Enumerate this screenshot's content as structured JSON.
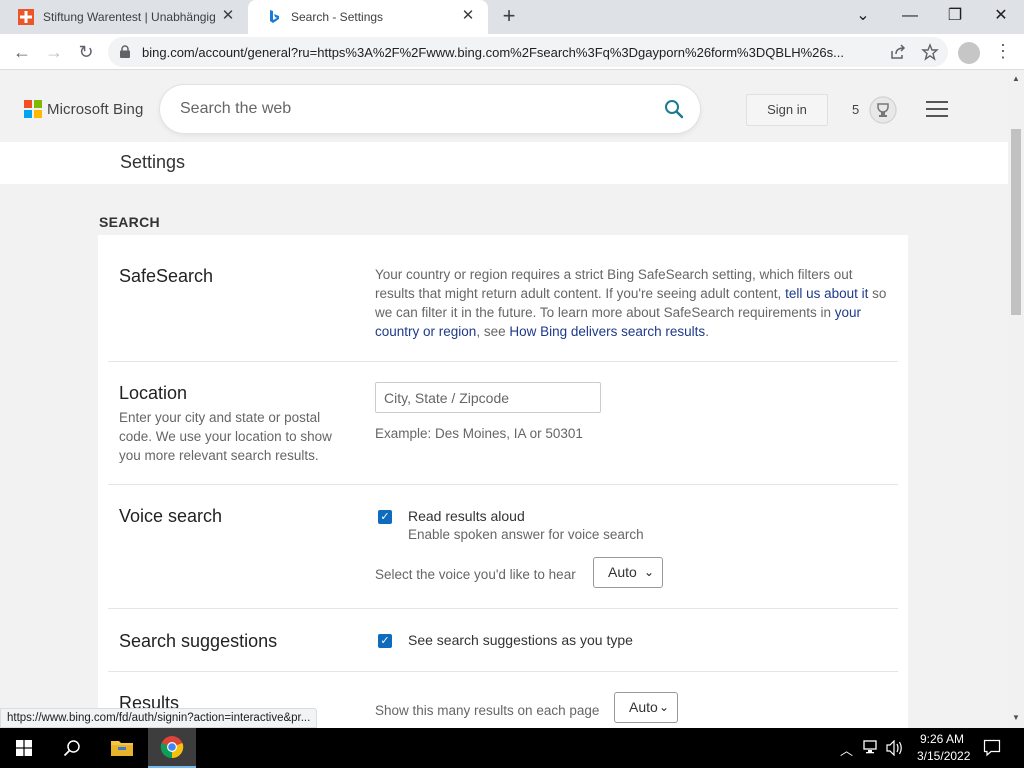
{
  "browser": {
    "tabs": [
      {
        "title": "Stiftung Warentest | Unabhängig",
        "favicon": "stiftung-warentest-icon",
        "active": false
      },
      {
        "title": "Search - Settings",
        "favicon": "bing-icon",
        "active": true
      }
    ],
    "url": "bing.com/account/general?ru=https%3A%2F%2Fwww.bing.com%2Fsearch%3Fq%3Dgayporn%26form%3DQBLH%26s...",
    "status_url": "https://www.bing.com/fd/auth/signin?action=interactive&pr..."
  },
  "header": {
    "brand": "Microsoft Bing",
    "search_placeholder": "Search the web",
    "sign_in": "Sign in",
    "rewards_count": "5"
  },
  "settings": {
    "page_title": "Settings",
    "section": "SEARCH",
    "safesearch": {
      "title": "SafeSearch",
      "text_1": "Your country or region requires a strict Bing SafeSearch setting, which filters out results that might return adult content. If you're seeing adult content, ",
      "link_1": "tell us about it",
      "text_2": " so we can filter it in the future. To learn more about SafeSearch requirements in ",
      "link_2": "your country or region",
      "text_3": ", see ",
      "link_3": "How Bing delivers search results",
      "text_4": "."
    },
    "location": {
      "title": "Location",
      "description": "Enter your city and state or postal code. We use your location to show you more relevant search results.",
      "placeholder": "City, State / Zipcode",
      "example": "Example: Des Moines, IA or 50301"
    },
    "voice": {
      "title": "Voice search",
      "checkbox_label": "Read results aloud",
      "checkbox_sub": "Enable spoken answer for voice search",
      "checked": true,
      "voice_label": "Select the voice you'd like to hear",
      "voice_value": "Auto"
    },
    "suggestions": {
      "title": "Search suggestions",
      "checkbox_label": "See search suggestions as you type",
      "checked": true
    },
    "results": {
      "title": "Results",
      "label": "Show this many results on each page",
      "value": "Auto"
    }
  },
  "taskbar": {
    "time": "9:26 AM",
    "date": "3/15/2022"
  },
  "colors": {
    "accent_blue": "#0f6cbd",
    "bing_teal": "#1a7b8f",
    "link": "#1e3a8a"
  }
}
